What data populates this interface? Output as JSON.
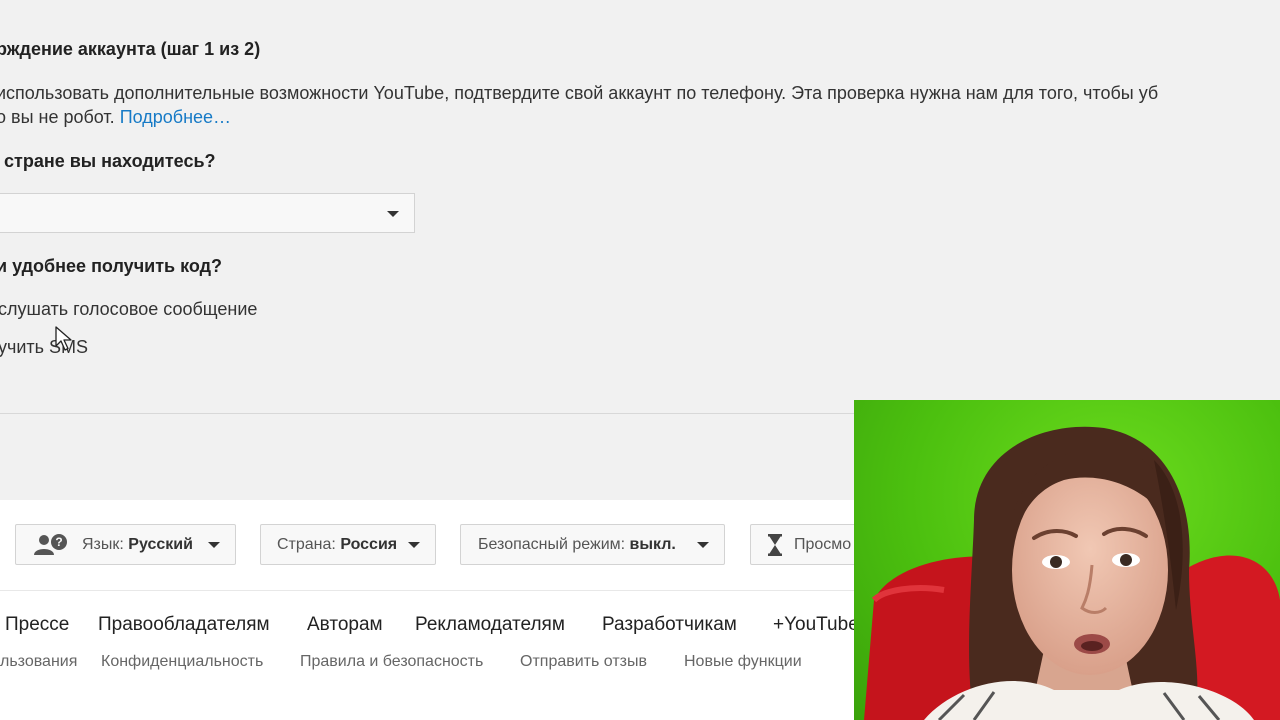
{
  "verification": {
    "title": "рждение аккаунта (шаг 1 из 2)",
    "description_line1": "использовать дополнительные возможности YouTube, подтвердите свой аккаунт по телефону. Эта проверка нужна нам для того, чтобы уб",
    "description_line2": "о вы не робот.",
    "more_link": "Подробнее…",
    "country_question": "стране вы находитесь?",
    "country_select_value": "|",
    "method_question": "и удобнее получить код?",
    "options": [
      {
        "label": "слушать голосовое сообщение"
      },
      {
        "label": "учить SMS"
      }
    ]
  },
  "footer": {
    "language": {
      "prefix": "Язык:",
      "value": "Русский"
    },
    "country": {
      "prefix": "Страна:",
      "value": "Россия"
    },
    "safety": {
      "prefix": "Безопасный режим:",
      "value": "выкл."
    },
    "history_label": "Просмо",
    "links": [
      "Прессе",
      "Правообладателям",
      "Авторам",
      "Рекламодателям",
      "Разработчикам",
      "+YouTube"
    ],
    "sublinks": [
      "льзования",
      "Конфиденциальность",
      "Правила и безопасность",
      "Отправить отзыв",
      "Новые функции"
    ]
  },
  "colors": {
    "link": "#167ac6",
    "webcam_background": "#4cc00f"
  },
  "icons": {
    "language_icon": "users-help-icon",
    "history_icon": "hourglass-icon",
    "caret": "caret-down-icon",
    "cursor": "mouse-pointer-icon"
  }
}
